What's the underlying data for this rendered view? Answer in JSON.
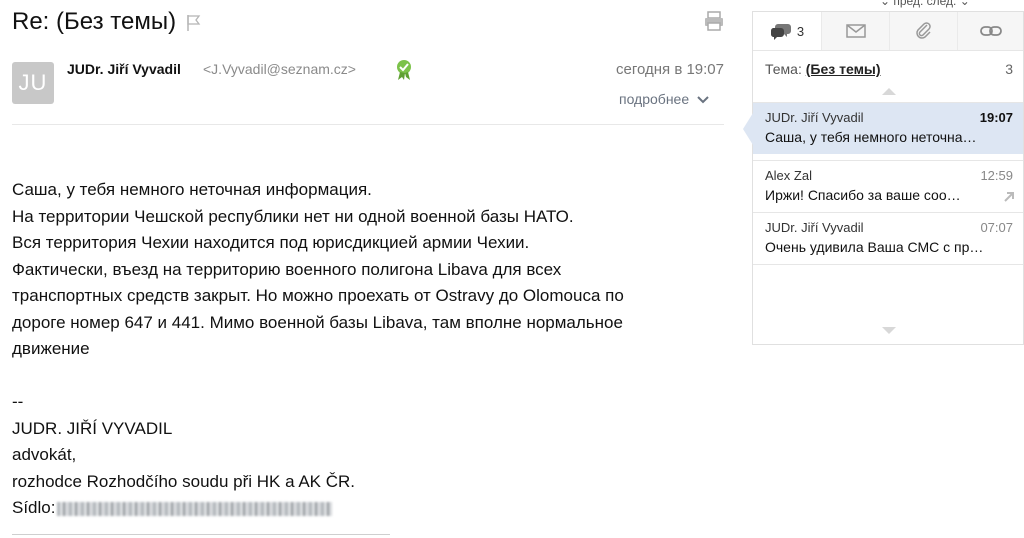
{
  "top_nav": {
    "label": "⌄ пред.   след. ⌄"
  },
  "message": {
    "subject": "Re: (Без темы)",
    "avatar_initials": "JU",
    "sender_name": "JUDr. Jiří Vyvadil",
    "sender_email": "<J.Vyvadil@seznam.cz>",
    "date": "сегодня в 19:07",
    "details_label": "подробнее",
    "body_lines": [
      "Саша, у тебя немного неточная информация.",
      "На территории Чешской республики нет ни одной военной базы НАТО.",
      "Вся территория Чехии находится под юрисдикцией армии Чехии.",
      "Фактически, въезд на территорию военного полигона Libava для всех",
      "транспортных средств закрыт. Но можно проехать от Ostravy до Olomouca по",
      "дороге номер 647 и 441. Мимо военной базы Libava, там вполне нормальное",
      "движение"
    ],
    "signature": {
      "dash": "--",
      "name": "JUDR. JIŘÍ VYVADIL",
      "title": "advokát,",
      "role": "rozhodce Rozhodčího soudu při HK a AK ČR.",
      "address_label": "Sídlo:"
    }
  },
  "thread_panel": {
    "tabs": [
      {
        "icon": "chat-bubbles-icon",
        "count": "3"
      },
      {
        "icon": "envelope-icon"
      },
      {
        "icon": "paperclip-icon"
      },
      {
        "icon": "link-icon"
      }
    ],
    "topic_label": "Тема:",
    "topic_value": "(Без темы)",
    "topic_count": "3",
    "messages": [
      {
        "sender": "JUDr. Jiří Vyvadil",
        "time": "19:07",
        "snippet": "Саша, у тебя немного неточна…",
        "active": true
      },
      {
        "sender": "Alex Zal",
        "time": "12:59",
        "snippet": "Иржи! Спасибо за ваше соо…",
        "active": false
      },
      {
        "sender": "JUDr. Jiří Vyvadil",
        "time": "07:07",
        "snippet": "Очень удивила Ваша СМС с пр…",
        "active": false
      }
    ]
  },
  "colors": {
    "active_row": "#dde6f3",
    "verified_badge": "#7cc24a",
    "muted_text": "#8a8a8a"
  }
}
